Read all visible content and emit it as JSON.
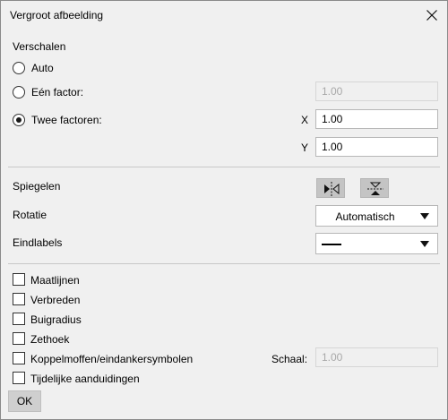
{
  "window": {
    "title": "Vergroot afbeelding"
  },
  "scale": {
    "section_label": "Verschalen",
    "options": [
      {
        "label": "Auto",
        "checked": false
      },
      {
        "label": "Eén factor:",
        "checked": false
      },
      {
        "label": "Twee factoren:",
        "checked": true
      }
    ],
    "single_factor_value": "1.00",
    "x_label": "X",
    "x_value": "1.00",
    "y_label": "Y",
    "y_value": "1.00"
  },
  "mirror": {
    "label": "Spiegelen"
  },
  "rotation": {
    "label": "Rotatie",
    "value": "Automatisch"
  },
  "end_labels": {
    "label": "Eindlabels"
  },
  "checkboxes": [
    {
      "label": "Maatlijnen",
      "checked": false
    },
    {
      "label": "Verbreden",
      "checked": false
    },
    {
      "label": "Buigradius",
      "checked": false
    },
    {
      "label": "Zethoek",
      "checked": false
    },
    {
      "label": "Koppelmoffen/eindankersymbolen",
      "checked": false
    },
    {
      "label": "Tijdelijke aanduidingen",
      "checked": false
    }
  ],
  "coupler_scale": {
    "label": "Schaal:",
    "value": "1.00"
  },
  "ok_label": "OK",
  "icons": [
    "close-icon",
    "mirror-horizontal-icon",
    "mirror-vertical-icon",
    "dropdown-arrow-icon"
  ]
}
